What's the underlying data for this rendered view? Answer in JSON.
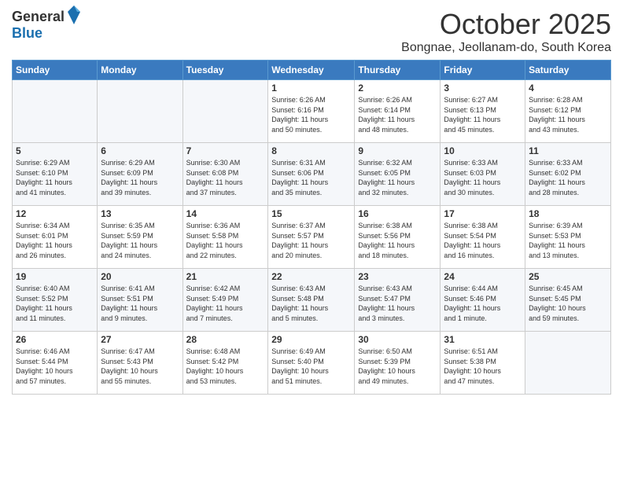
{
  "logo": {
    "general": "General",
    "blue": "Blue"
  },
  "header": {
    "month": "October 2025",
    "location": "Bongnae, Jeollanam-do, South Korea"
  },
  "weekdays": [
    "Sunday",
    "Monday",
    "Tuesday",
    "Wednesday",
    "Thursday",
    "Friday",
    "Saturday"
  ],
  "weeks": [
    [
      {
        "day": "",
        "info": ""
      },
      {
        "day": "",
        "info": ""
      },
      {
        "day": "",
        "info": ""
      },
      {
        "day": "1",
        "info": "Sunrise: 6:26 AM\nSunset: 6:16 PM\nDaylight: 11 hours\nand 50 minutes."
      },
      {
        "day": "2",
        "info": "Sunrise: 6:26 AM\nSunset: 6:14 PM\nDaylight: 11 hours\nand 48 minutes."
      },
      {
        "day": "3",
        "info": "Sunrise: 6:27 AM\nSunset: 6:13 PM\nDaylight: 11 hours\nand 45 minutes."
      },
      {
        "day": "4",
        "info": "Sunrise: 6:28 AM\nSunset: 6:12 PM\nDaylight: 11 hours\nand 43 minutes."
      }
    ],
    [
      {
        "day": "5",
        "info": "Sunrise: 6:29 AM\nSunset: 6:10 PM\nDaylight: 11 hours\nand 41 minutes."
      },
      {
        "day": "6",
        "info": "Sunrise: 6:29 AM\nSunset: 6:09 PM\nDaylight: 11 hours\nand 39 minutes."
      },
      {
        "day": "7",
        "info": "Sunrise: 6:30 AM\nSunset: 6:08 PM\nDaylight: 11 hours\nand 37 minutes."
      },
      {
        "day": "8",
        "info": "Sunrise: 6:31 AM\nSunset: 6:06 PM\nDaylight: 11 hours\nand 35 minutes."
      },
      {
        "day": "9",
        "info": "Sunrise: 6:32 AM\nSunset: 6:05 PM\nDaylight: 11 hours\nand 32 minutes."
      },
      {
        "day": "10",
        "info": "Sunrise: 6:33 AM\nSunset: 6:03 PM\nDaylight: 11 hours\nand 30 minutes."
      },
      {
        "day": "11",
        "info": "Sunrise: 6:33 AM\nSunset: 6:02 PM\nDaylight: 11 hours\nand 28 minutes."
      }
    ],
    [
      {
        "day": "12",
        "info": "Sunrise: 6:34 AM\nSunset: 6:01 PM\nDaylight: 11 hours\nand 26 minutes."
      },
      {
        "day": "13",
        "info": "Sunrise: 6:35 AM\nSunset: 5:59 PM\nDaylight: 11 hours\nand 24 minutes."
      },
      {
        "day": "14",
        "info": "Sunrise: 6:36 AM\nSunset: 5:58 PM\nDaylight: 11 hours\nand 22 minutes."
      },
      {
        "day": "15",
        "info": "Sunrise: 6:37 AM\nSunset: 5:57 PM\nDaylight: 11 hours\nand 20 minutes."
      },
      {
        "day": "16",
        "info": "Sunrise: 6:38 AM\nSunset: 5:56 PM\nDaylight: 11 hours\nand 18 minutes."
      },
      {
        "day": "17",
        "info": "Sunrise: 6:38 AM\nSunset: 5:54 PM\nDaylight: 11 hours\nand 16 minutes."
      },
      {
        "day": "18",
        "info": "Sunrise: 6:39 AM\nSunset: 5:53 PM\nDaylight: 11 hours\nand 13 minutes."
      }
    ],
    [
      {
        "day": "19",
        "info": "Sunrise: 6:40 AM\nSunset: 5:52 PM\nDaylight: 11 hours\nand 11 minutes."
      },
      {
        "day": "20",
        "info": "Sunrise: 6:41 AM\nSunset: 5:51 PM\nDaylight: 11 hours\nand 9 minutes."
      },
      {
        "day": "21",
        "info": "Sunrise: 6:42 AM\nSunset: 5:49 PM\nDaylight: 11 hours\nand 7 minutes."
      },
      {
        "day": "22",
        "info": "Sunrise: 6:43 AM\nSunset: 5:48 PM\nDaylight: 11 hours\nand 5 minutes."
      },
      {
        "day": "23",
        "info": "Sunrise: 6:43 AM\nSunset: 5:47 PM\nDaylight: 11 hours\nand 3 minutes."
      },
      {
        "day": "24",
        "info": "Sunrise: 6:44 AM\nSunset: 5:46 PM\nDaylight: 11 hours\nand 1 minute."
      },
      {
        "day": "25",
        "info": "Sunrise: 6:45 AM\nSunset: 5:45 PM\nDaylight: 10 hours\nand 59 minutes."
      }
    ],
    [
      {
        "day": "26",
        "info": "Sunrise: 6:46 AM\nSunset: 5:44 PM\nDaylight: 10 hours\nand 57 minutes."
      },
      {
        "day": "27",
        "info": "Sunrise: 6:47 AM\nSunset: 5:43 PM\nDaylight: 10 hours\nand 55 minutes."
      },
      {
        "day": "28",
        "info": "Sunrise: 6:48 AM\nSunset: 5:42 PM\nDaylight: 10 hours\nand 53 minutes."
      },
      {
        "day": "29",
        "info": "Sunrise: 6:49 AM\nSunset: 5:40 PM\nDaylight: 10 hours\nand 51 minutes."
      },
      {
        "day": "30",
        "info": "Sunrise: 6:50 AM\nSunset: 5:39 PM\nDaylight: 10 hours\nand 49 minutes."
      },
      {
        "day": "31",
        "info": "Sunrise: 6:51 AM\nSunset: 5:38 PM\nDaylight: 10 hours\nand 47 minutes."
      },
      {
        "day": "",
        "info": ""
      }
    ]
  ]
}
